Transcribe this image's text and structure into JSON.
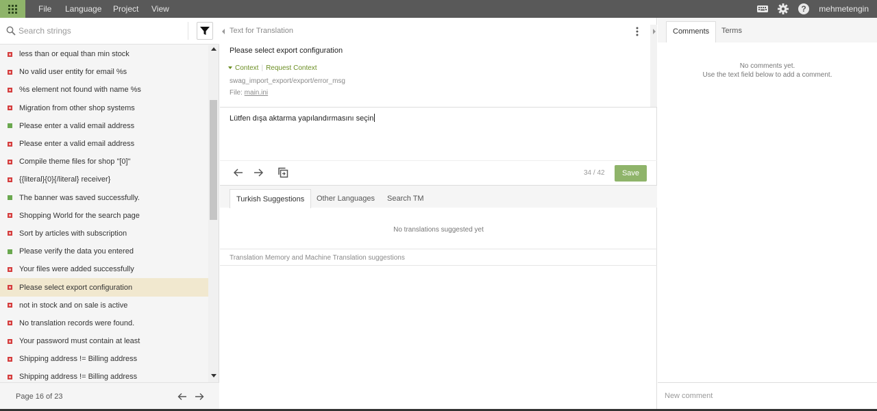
{
  "topbar": {
    "menus": [
      "File",
      "Language",
      "Project",
      "View"
    ],
    "username": "mehmetengin"
  },
  "left": {
    "search_placeholder": "Search strings",
    "strings": [
      {
        "text": "less than or equal than min stock",
        "status": "red"
      },
      {
        "text": "No valid user entity for email %s",
        "status": "red"
      },
      {
        "text": "%s element not found with name %s",
        "status": "red"
      },
      {
        "text": "Migration from other shop systems",
        "status": "red"
      },
      {
        "text": "Please enter a valid email address",
        "status": "green"
      },
      {
        "text": "Please enter a valid email address",
        "status": "red"
      },
      {
        "text": "Compile theme files for shop \"[0]\"",
        "status": "red"
      },
      {
        "text": "{{literal}{0}{/literal} receiver}",
        "status": "red"
      },
      {
        "text": "The banner was saved successfully.",
        "status": "green"
      },
      {
        "text": "Shopping World for the search page",
        "status": "red"
      },
      {
        "text": "Sort by articles with subscription",
        "status": "red"
      },
      {
        "text": "Please verify the data you entered",
        "status": "green"
      },
      {
        "text": "Your files were added successfully",
        "status": "red"
      },
      {
        "text": "Please select export configuration",
        "status": "red",
        "selected": true
      },
      {
        "text": "not in stock and on sale is active",
        "status": "red"
      },
      {
        "text": "No translation records were found.",
        "status": "red"
      },
      {
        "text": "Your password must contain at least",
        "status": "red"
      },
      {
        "text": "Shipping address != Billing address",
        "status": "red"
      },
      {
        "text": "Shipping address != Billing address",
        "status": "red"
      }
    ],
    "page_text": "Page 16 of 23"
  },
  "center": {
    "source_header": "Text for Translation",
    "source_text": "Please select export configuration",
    "context_label": "Context",
    "request_context_label": "Request Context",
    "context_key": "swag_import_export/export/error_msg",
    "file_prefix": "File: ",
    "file_name": "main.ini",
    "translation_text": "Lütfen dışa aktarma yapılandırmasını seçin",
    "counter": "34 / 42",
    "save_label": "Save",
    "tabs": [
      "Turkish Suggestions",
      "Other Languages",
      "Search TM"
    ],
    "no_suggestions": "No translations suggested yet",
    "tm_info": "Translation Memory and Machine Translation suggestions"
  },
  "right": {
    "tabs": [
      "Comments",
      "Terms"
    ],
    "no_comments_line1": "No comments yet.",
    "no_comments_line2": "Use the text field below to add a comment.",
    "new_comment_placeholder": "New comment"
  },
  "colors": {
    "topbar": "#595959",
    "accent_green": "#8fb46a",
    "selected_row": "#f1e8cf",
    "status_red": "#d43c3c",
    "status_green": "#6aa84f",
    "context_link": "#6b8e23"
  }
}
